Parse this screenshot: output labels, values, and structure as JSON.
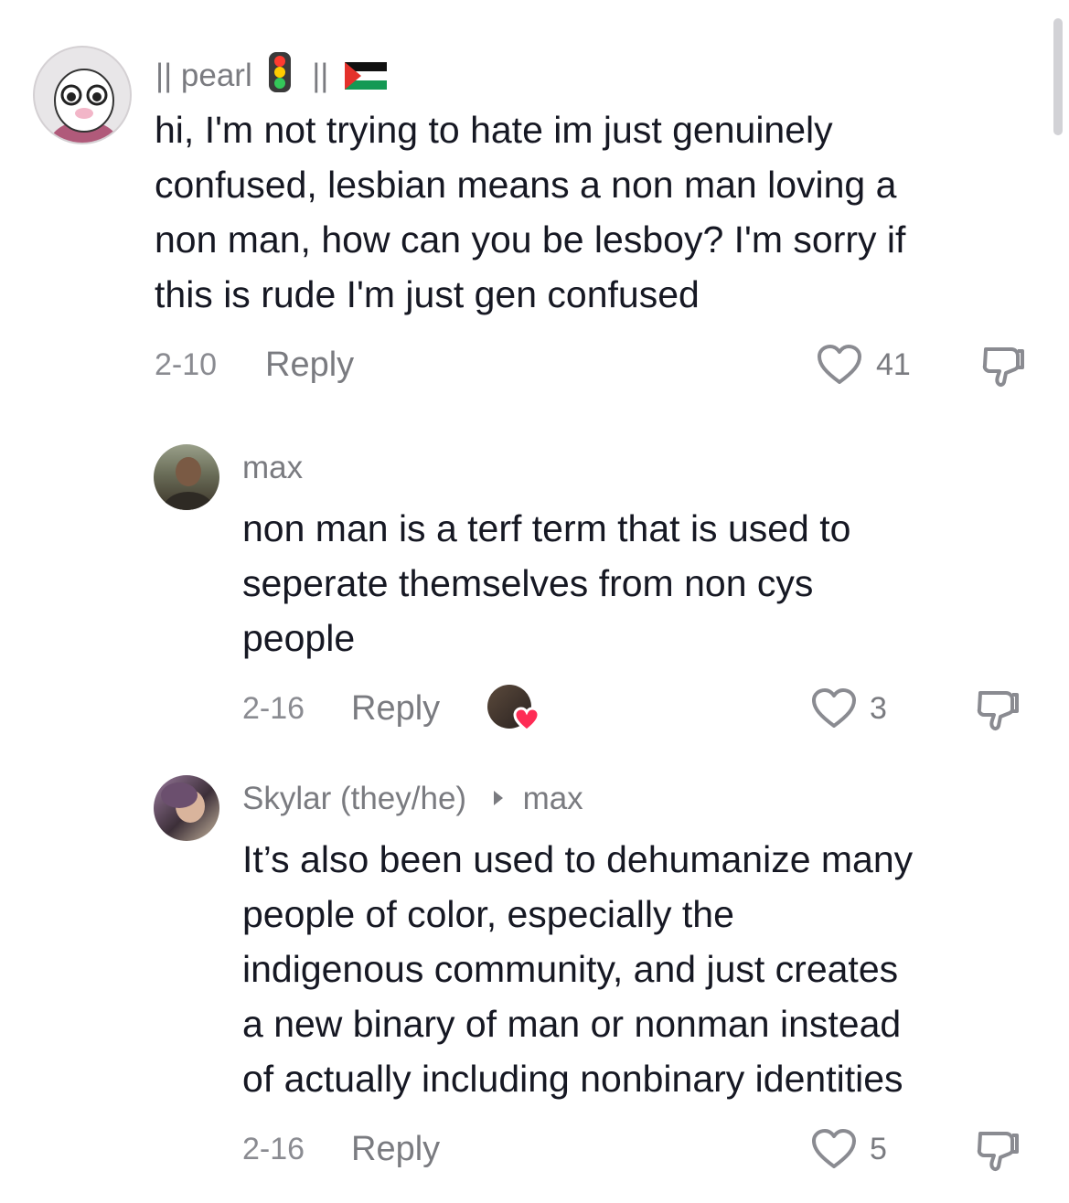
{
  "comments": [
    {
      "username": "|| pearl",
      "username_suffix": "||",
      "traffic_light_emoji": "traffic-light-icon",
      "flag_emoji": "palestine-flag-icon",
      "text": "hi, I'm not trying to hate im just genuinely confused, lesbian means a non man loving a non man, how can you be lesboy? I'm sorry if this is rude I'm just gen confused",
      "lines": [
        "hi, I'm not trying to hate im just genuinely",
        "confused, lesbian means a non man loving a",
        "non man, how can you be lesboy? I'm sorry if",
        "this is rude I'm just gen confused"
      ],
      "date": "2-10",
      "reply_label": "Reply",
      "likes": "41"
    },
    {
      "username": "max",
      "lines": [
        "non man is a terf term that is used to",
        "seperate themselves from non cys",
        "people"
      ],
      "date": "2-16",
      "reply_label": "Reply",
      "likes": "3",
      "creator_liked": true
    },
    {
      "username": "Skylar (they/he)",
      "reply_to": "max",
      "lines": [
        "It’s also been used to dehumanize many",
        "people of color, especially the",
        "indigenous community, and just creates",
        "a new binary of man or nonman instead",
        "of actually including nonbinary identities"
      ],
      "date": "2-16",
      "reply_label": "Reply",
      "likes": "5"
    }
  ],
  "colors": {
    "text": "#161823",
    "muted": "#7a7b80",
    "heart_badge": "#fe2c55"
  }
}
